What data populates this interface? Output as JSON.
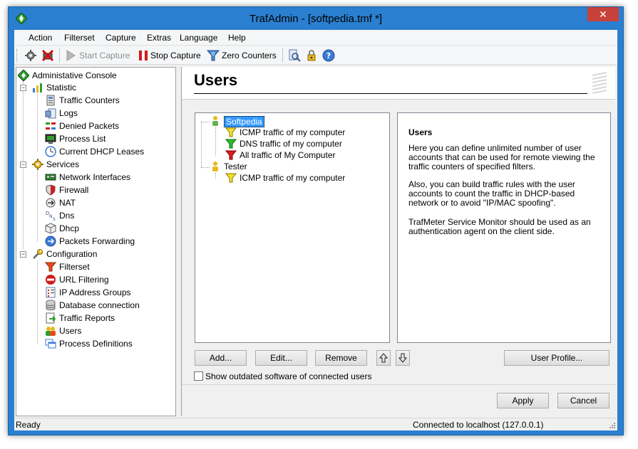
{
  "window": {
    "title": "TrafAdmin - [softpedia.tmf *]",
    "close_glyph": "✕"
  },
  "menu": [
    "Action",
    "Filterset",
    "Capture",
    "Extras",
    "Language",
    "Help"
  ],
  "toolbar": {
    "start_capture": "Start Capture",
    "stop_capture": "Stop Capture",
    "zero_counters": "Zero Counters"
  },
  "nav": {
    "root": "Administative Console",
    "statistic": "Statistic",
    "statistic_items": [
      "Traffic Counters",
      "Logs",
      "Denied Packets",
      "Process List",
      "Current DHCP Leases"
    ],
    "services": "Services",
    "services_items": [
      "Network Interfaces",
      "Firewall",
      "NAT",
      "Dns",
      "Dhcp",
      "Packets Forwarding"
    ],
    "configuration": "Configuration",
    "configuration_items": [
      "Filterset",
      "URL Filtering",
      "IP Address Groups",
      "Database connection",
      "Traffic Reports",
      "Users",
      "Process Definitions"
    ]
  },
  "page": {
    "title": "Users"
  },
  "users_tree": {
    "user1": "Softpedia",
    "user1_items": [
      "ICMP traffic of my computer",
      "DNS traffic of my computer",
      "All traffic of My Computer"
    ],
    "user2": "Tester",
    "user2_items": [
      "ICMP traffic of my computer"
    ]
  },
  "info": {
    "heading": "Users",
    "p1": "Here you can define unlimited number of user accounts that can be used for remote viewing the traffic counters of specified filters.",
    "p2": "Also, you can build traffic rules with the user accounts to count the traffic in DHCP-based network or to avoid \"IP/MAC spoofing\".",
    "p3": "TrafMeter Service Monitor should be used as an authentication agent on the client side."
  },
  "buttons": {
    "add": "Add...",
    "edit": "Edit...",
    "remove": "Remove",
    "user_profile": "User Profile...",
    "apply": "Apply",
    "cancel": "Cancel"
  },
  "checkbox": {
    "label": "Show outdated software of connected users",
    "checked": false
  },
  "status": {
    "left": "Ready",
    "right": "Connected to localhost (127.0.0.1)"
  },
  "colors": {
    "titlebar": "#2a7fd0",
    "close": "#c7413b",
    "selection": "#3399ff"
  }
}
